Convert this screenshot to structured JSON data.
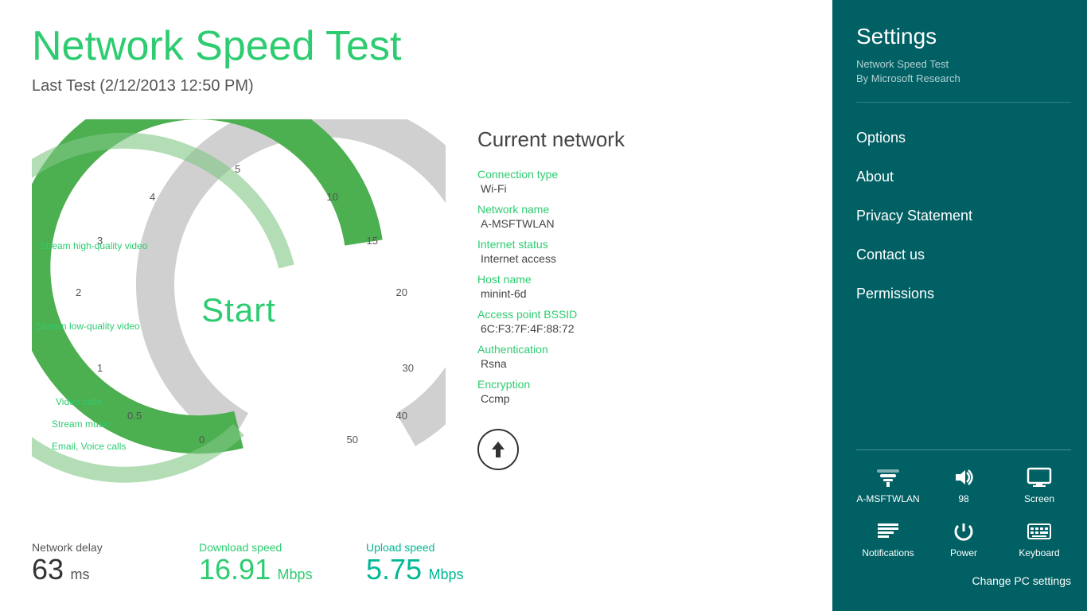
{
  "app": {
    "title": "Network Speed Test",
    "last_test": "Last Test (2/12/2013 12:50 PM)"
  },
  "gauge": {
    "start_label": "Start",
    "scale": [
      "0",
      "0.5",
      "1",
      "2",
      "3",
      "4",
      "5",
      "10",
      "15",
      "20",
      "30",
      "40",
      "50"
    ],
    "annotations": [
      {
        "label": "Stream high-quality video",
        "value": "3"
      },
      {
        "label": "Stream low-quality video",
        "value": "2"
      },
      {
        "label": "Video calls",
        "value": "0.5"
      },
      {
        "label": "Stream music",
        "value": ""
      },
      {
        "label": "Email, Voice calls",
        "value": ""
      }
    ]
  },
  "network": {
    "title": "Current network",
    "fields": [
      {
        "label": "Connection type",
        "value": "Wi-Fi"
      },
      {
        "label": "Network name",
        "value": "A-MSFTWLAN"
      },
      {
        "label": "Internet status",
        "value": "Internet access"
      },
      {
        "label": "Host name",
        "value": "minint-6d"
      },
      {
        "label": "Access point BSSID",
        "value": "6C:F3:7F:4F:88:72"
      },
      {
        "label": "Authentication",
        "value": "Rsna"
      },
      {
        "label": "Encryption",
        "value": "Ccmp"
      }
    ]
  },
  "stats": {
    "network_delay_label": "Network delay",
    "network_delay_value": "63",
    "network_delay_unit": "ms",
    "download_label": "Download speed",
    "download_value": "16.91",
    "download_unit": "Mbps",
    "upload_label": "Upload speed",
    "upload_value": "5.75",
    "upload_unit": "Mbps"
  },
  "settings": {
    "title": "Settings",
    "app_name": "Network Speed Test",
    "app_author": "By Microsoft Research",
    "menu_items": [
      {
        "label": "Options",
        "name": "options"
      },
      {
        "label": "About",
        "name": "about"
      },
      {
        "label": "Privacy Statement",
        "name": "privacy-statement"
      },
      {
        "label": "Contact us",
        "name": "contact-us"
      },
      {
        "label": "Permissions",
        "name": "permissions"
      }
    ],
    "system_icons": [
      {
        "label": "A-MSFTWLAN",
        "name": "wifi-icon"
      },
      {
        "label": "98",
        "name": "volume-icon"
      },
      {
        "label": "Screen",
        "name": "screen-icon"
      },
      {
        "label": "Notifications",
        "name": "notifications-icon"
      },
      {
        "label": "Power",
        "name": "power-icon"
      },
      {
        "label": "Keyboard",
        "name": "keyboard-icon"
      }
    ],
    "change_pc_settings": "Change PC settings"
  }
}
